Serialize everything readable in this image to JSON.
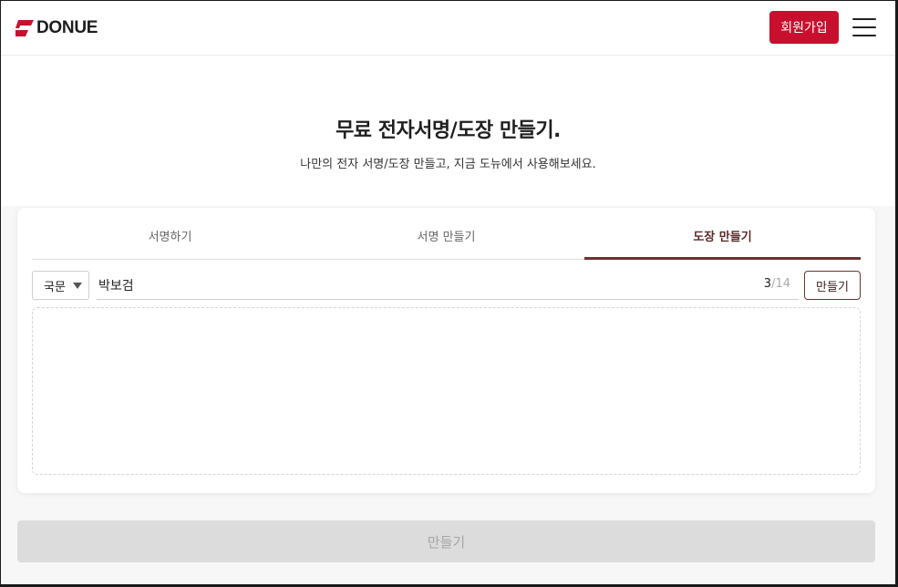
{
  "header": {
    "logo_text": "DONUE",
    "signup_label": "회원가입",
    "brand_color": "#c8102e",
    "menu_icon": "hamburger-menu-icon"
  },
  "hero": {
    "title": "무료 전자서명/도장 만들기.",
    "subtitle": "나만의 전자 서명/도장 만들고, 지금 도뉴에서 사용해보세요."
  },
  "tabs": [
    {
      "label": "서명하기",
      "active": false
    },
    {
      "label": "서명 만들기",
      "active": false
    },
    {
      "label": "도장 만들기",
      "active": true
    }
  ],
  "stamp_form": {
    "font_select_value": "국문",
    "name_value": "박보검",
    "char_count": "3",
    "char_separator": "/",
    "char_max": "14",
    "make_button_label": "만들기"
  },
  "footer": {
    "make_button_label": "만들기",
    "disabled": true
  },
  "colors": {
    "accent": "#6b3330",
    "brand_red": "#c8102e",
    "disabled_bg": "#dcdcdc"
  }
}
